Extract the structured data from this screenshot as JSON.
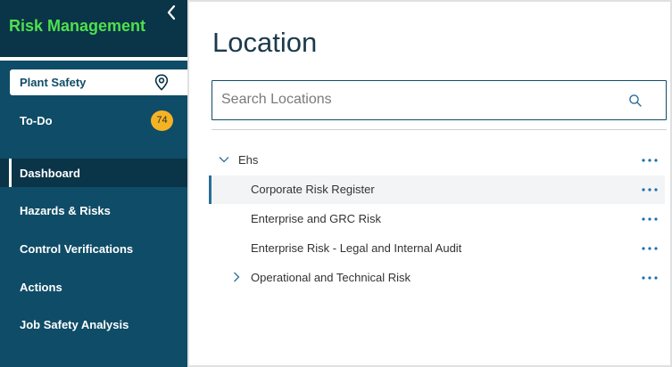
{
  "app": {
    "title": "Risk Management"
  },
  "sidebar": {
    "location": {
      "label": "Plant Safety"
    },
    "todo": {
      "label": "To-Do",
      "count": "74"
    },
    "items": [
      {
        "label": "Dashboard",
        "active": true
      },
      {
        "label": "Hazards & Risks"
      },
      {
        "label": "Control Verifications"
      },
      {
        "label": "Actions"
      },
      {
        "label": "Job Safety Analysis"
      }
    ]
  },
  "main": {
    "title": "Location",
    "search": {
      "placeholder": "Search Locations",
      "value": ""
    },
    "tree": [
      {
        "label": "Ehs",
        "expanded": true,
        "level": 0
      },
      {
        "label": "Corporate Risk Register",
        "level": 1,
        "selected": true
      },
      {
        "label": "Enterprise and GRC Risk",
        "level": 1
      },
      {
        "label": "Enterprise Risk - Legal and Internal Audit",
        "level": 1
      },
      {
        "label": "Operational and Technical Risk",
        "level": 1,
        "expanded": false
      }
    ]
  },
  "colors": {
    "sidebar": "#0f4c67",
    "sidebar_header": "#0a3448",
    "brand_green": "#4ee04e",
    "badge": "#f5b324",
    "accent": "#2a6f98"
  }
}
